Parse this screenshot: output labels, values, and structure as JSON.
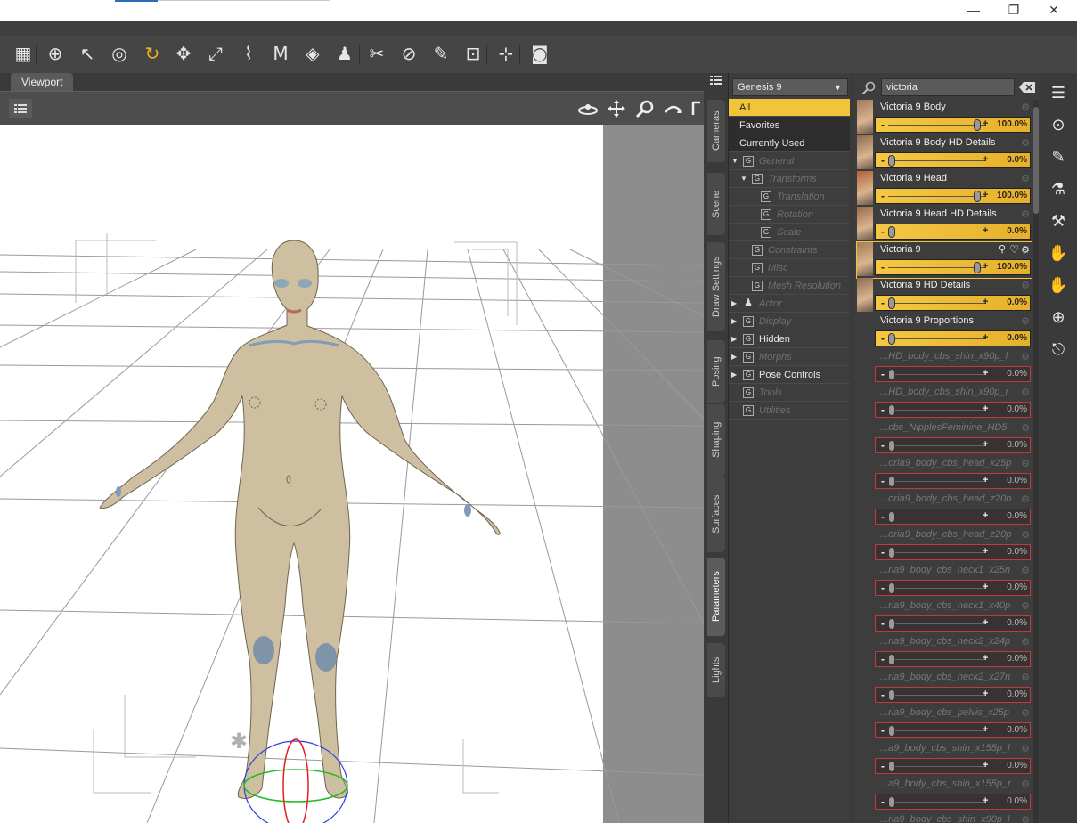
{
  "window": {
    "minimize": "—",
    "restore": "❐",
    "close": "✕"
  },
  "toolbar": {
    "tools": [
      "grid-icon",
      "universal-tool-icon",
      "select-arrow-icon",
      "node-select-icon",
      "rotate-tool-icon",
      "translate-tool-icon",
      "scale-tool-icon",
      "joint-editor-icon",
      "geometry-editor-icon",
      "surface-selection-icon",
      "figure-setup-icon",
      "node-weight-icon",
      "geometry-sculptor-icon",
      "edit-brush-icon",
      "spot-render-icon",
      "region-nav-icon",
      "camera-icon"
    ]
  },
  "viewport": {
    "tab_label": "Viewport"
  },
  "side_tabs": [
    "Cameras",
    "Scene",
    "Draw Settings",
    "Posing",
    "Shaping",
    "Surfaces",
    "Parameters",
    "Lights"
  ],
  "tree": {
    "node_selector": "Genesis 9",
    "items": [
      {
        "label": "All",
        "state": "selected"
      },
      {
        "label": "Favorites",
        "state": "dark"
      },
      {
        "label": "Currently Used",
        "state": "dark"
      },
      {
        "label": "General",
        "state": "dim"
      },
      {
        "label": "Transforms",
        "state": "dim"
      },
      {
        "label": "Translation",
        "state": "dim"
      },
      {
        "label": "Rotation",
        "state": "dim"
      },
      {
        "label": "Scale",
        "state": "dim"
      },
      {
        "label": "Constraints",
        "state": "dim"
      },
      {
        "label": "Misc",
        "state": "dim"
      },
      {
        "label": "Mesh Resolution",
        "state": "dim"
      },
      {
        "label": "Actor",
        "state": "dim"
      },
      {
        "label": "Display",
        "state": "dim"
      },
      {
        "label": "Hidden",
        "state": "normal"
      },
      {
        "label": "Morphs",
        "state": "dim"
      },
      {
        "label": "Pose Controls",
        "state": "normal"
      },
      {
        "label": "Tools",
        "state": "dim"
      },
      {
        "label": "Utilities",
        "state": "dim"
      }
    ]
  },
  "search": {
    "value": "victoria"
  },
  "properties": [
    {
      "name": "Victoria 9 Body",
      "value": "100.0%",
      "fraction": 1.0,
      "active": true
    },
    {
      "name": "Victoria 9 Body HD Details",
      "value": "0.0%",
      "fraction": 0.0,
      "active": true
    },
    {
      "name": "Victoria 9 Head",
      "value": "100.0%",
      "fraction": 1.0,
      "active": true
    },
    {
      "name": "Victoria 9 Head HD Details",
      "value": "0.0%",
      "fraction": 0.0,
      "active": true
    },
    {
      "name": "Victoria 9",
      "value": "100.0%",
      "fraction": 1.0,
      "active": true,
      "selected": true
    },
    {
      "name": "Victoria 9 HD Details",
      "value": "0.0%",
      "fraction": 0.0,
      "active": true
    },
    {
      "name": "Victoria 9 Proportions",
      "value": "0.0%",
      "fraction": 0.0,
      "active": true
    },
    {
      "name": "...HD_body_cbs_shin_x90p_l",
      "value": "0.0%",
      "fraction": 0.0,
      "active": false
    },
    {
      "name": "...HD_body_cbs_shin_x90p_r",
      "value": "0.0%",
      "fraction": 0.0,
      "active": false
    },
    {
      "name": "...cbs_NipplesFeminine_HD5",
      "value": "0.0%",
      "fraction": 0.0,
      "active": false
    },
    {
      "name": "...oria9_body_cbs_head_x25p",
      "value": "0.0%",
      "fraction": 0.0,
      "active": false
    },
    {
      "name": "...oria9_body_cbs_head_z20n",
      "value": "0.0%",
      "fraction": 0.0,
      "active": false
    },
    {
      "name": "...oria9_body_cbs_head_z20p",
      "value": "0.0%",
      "fraction": 0.0,
      "active": false
    },
    {
      "name": "...ria9_body_cbs_neck1_x25n",
      "value": "0.0%",
      "fraction": 0.0,
      "active": false
    },
    {
      "name": "...ria9_body_cbs_neck1_x40p",
      "value": "0.0%",
      "fraction": 0.0,
      "active": false
    },
    {
      "name": "...ria9_body_cbs_neck2_x24p",
      "value": "0.0%",
      "fraction": 0.0,
      "active": false
    },
    {
      "name": "...ria9_body_cbs_neck2_x27n",
      "value": "0.0%",
      "fraction": 0.0,
      "active": false
    },
    {
      "name": "...ria9_body_cbs_pelvis_x25p",
      "value": "0.0%",
      "fraction": 0.0,
      "active": false
    },
    {
      "name": "...a9_body_cbs_shin_x155p_l",
      "value": "0.0%",
      "fraction": 0.0,
      "active": false
    },
    {
      "name": "...a9_body_cbs_shin_x155p_r",
      "value": "0.0%",
      "fraction": 0.0,
      "active": false
    },
    {
      "name": "...ria9_body_cbs_shin_x90p_l",
      "value": "",
      "fraction": 0.0,
      "active": false
    }
  ],
  "right_strip": [
    "panel-menu-icon",
    "content-library-icon",
    "brush-tool-icon",
    "color-picker-icon",
    "settings-brush-icon",
    "pose-hand-icon",
    "pose-hand-alt-icon",
    "globe-icon",
    "exit-icon"
  ]
}
